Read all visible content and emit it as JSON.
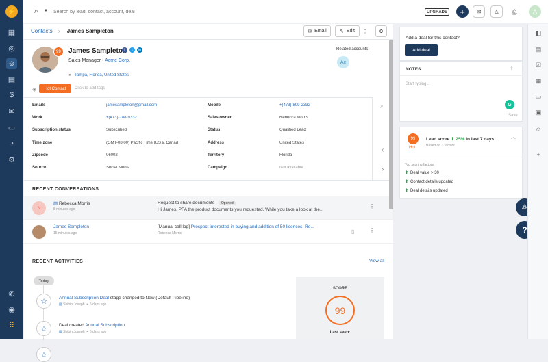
{
  "topbar": {
    "search_placeholder": "Search by lead, contact, account, deal",
    "upgrade": "UPGRADE",
    "avatar_letter": "A"
  },
  "header": {
    "breadcrumb_root": "Contacts",
    "breadcrumb_name": "James Sampleton",
    "email_btn": "Email",
    "edit_btn": "Edit"
  },
  "contact": {
    "score": "99",
    "name": "James Sampleton",
    "title_prefix": "Sales Manager",
    "sep": "•",
    "company": "Acme Corp.",
    "location": "Tampa, Florida, United States",
    "tag": "Hot Contact",
    "add_tags": "Click to add tags",
    "related_label": "Related accounts",
    "related_initials": "Ac"
  },
  "fields": {
    "left": [
      {
        "label": "Emails",
        "value": "jamesampleton@gmail.com",
        "link": true
      },
      {
        "label": "Work",
        "value": "+(473)-788-9332",
        "link": true
      },
      {
        "label": "Subscription status",
        "value": "Subscribed",
        "link": false
      },
      {
        "label": "Time zone",
        "value": "(GMT-08:00) Pacific Time (US & Canad",
        "link": false
      },
      {
        "label": "Zipcode",
        "value": "06002",
        "link": false
      },
      {
        "label": "Source",
        "value": "Social Media",
        "link": false
      }
    ],
    "right": [
      {
        "label": "Mobile",
        "value": "+(473)-899-2332",
        "link": true
      },
      {
        "label": "Sales owner",
        "value": "Rebecca Morris",
        "link": false
      },
      {
        "label": "Status",
        "value": "Qualified Lead",
        "link": false
      },
      {
        "label": "Address",
        "value": "United States",
        "link": false
      },
      {
        "label": "Territory",
        "value": "Florida",
        "link": false
      },
      {
        "label": "Campaign",
        "value": "Not available",
        "link": false
      }
    ]
  },
  "conversations": {
    "title": "RECENT CONVERSATIONS",
    "items": [
      {
        "initial": "N",
        "name": "Rebecca Morris",
        "time": "8 minutes ago",
        "subject": "Request to share documents",
        "status": "Opened",
        "body": "Hi James, PFA the product documents you requested. While you take a look at the...",
        "from": ""
      },
      {
        "initial": "",
        "name": "James Sampleton",
        "time": "15 minutes ago",
        "subject": "[Manual call log]",
        "status": "",
        "body": "Prospect interested in buying and addition of 50 licences. Re...",
        "from": "Rebecca Morris"
      }
    ]
  },
  "activities": {
    "title": "RECENT ACTIVITIES",
    "view_all": "View all",
    "today": "Today",
    "items": [
      {
        "link1": "Annual Subscription Deal",
        "text": " stage changed to New (Default Pipeline)",
        "prefix": "",
        "user": "Shibin Joseph",
        "time": "6 days ago"
      },
      {
        "link1": "Annual Subscription",
        "text": "",
        "prefix": "Deal created ",
        "user": "Shibin Joseph",
        "time": "6 days ago"
      }
    ],
    "score_label": "SCORE",
    "score": "99",
    "last_seen": "Last seen:"
  },
  "deal_card": {
    "question": "Add a deal for this contact?",
    "button": "Add deal"
  },
  "notes": {
    "title": "NOTES",
    "placeholder": "Start typing...",
    "save": "Save"
  },
  "lead_score": {
    "value": "99",
    "hot": "Hot",
    "label": "Lead score",
    "change": "25%",
    "suffix": "in last 7 days",
    "sub": "Based on 3 factors",
    "factors_title": "Top scoring factors",
    "factors": [
      "Deal value > 30",
      "Contact details updated",
      "Deal details updated"
    ]
  },
  "colors": {
    "nav": "#1d3a5c",
    "accent": "#f36d22",
    "link": "#2a6ebb"
  }
}
